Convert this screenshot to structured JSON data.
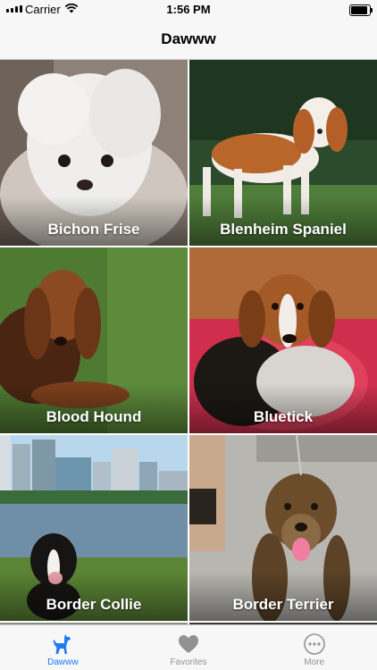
{
  "status_bar": {
    "carrier": "Carrier",
    "time": "1:56 PM"
  },
  "nav": {
    "title": "Dawww"
  },
  "breeds": [
    {
      "name": "Bichon Frise"
    },
    {
      "name": "Blenheim Spaniel"
    },
    {
      "name": "Blood Hound"
    },
    {
      "name": "Bluetick"
    },
    {
      "name": "Border Collie"
    },
    {
      "name": "Border Terrier"
    }
  ],
  "tabs": [
    {
      "label": "Dawww",
      "icon": "dog-icon",
      "active": true
    },
    {
      "label": "Favorites",
      "icon": "heart-icon",
      "active": false
    },
    {
      "label": "More",
      "icon": "more-icon",
      "active": false
    }
  ],
  "colors": {
    "accent": "#1d7bf5",
    "inactive": "#929292"
  }
}
